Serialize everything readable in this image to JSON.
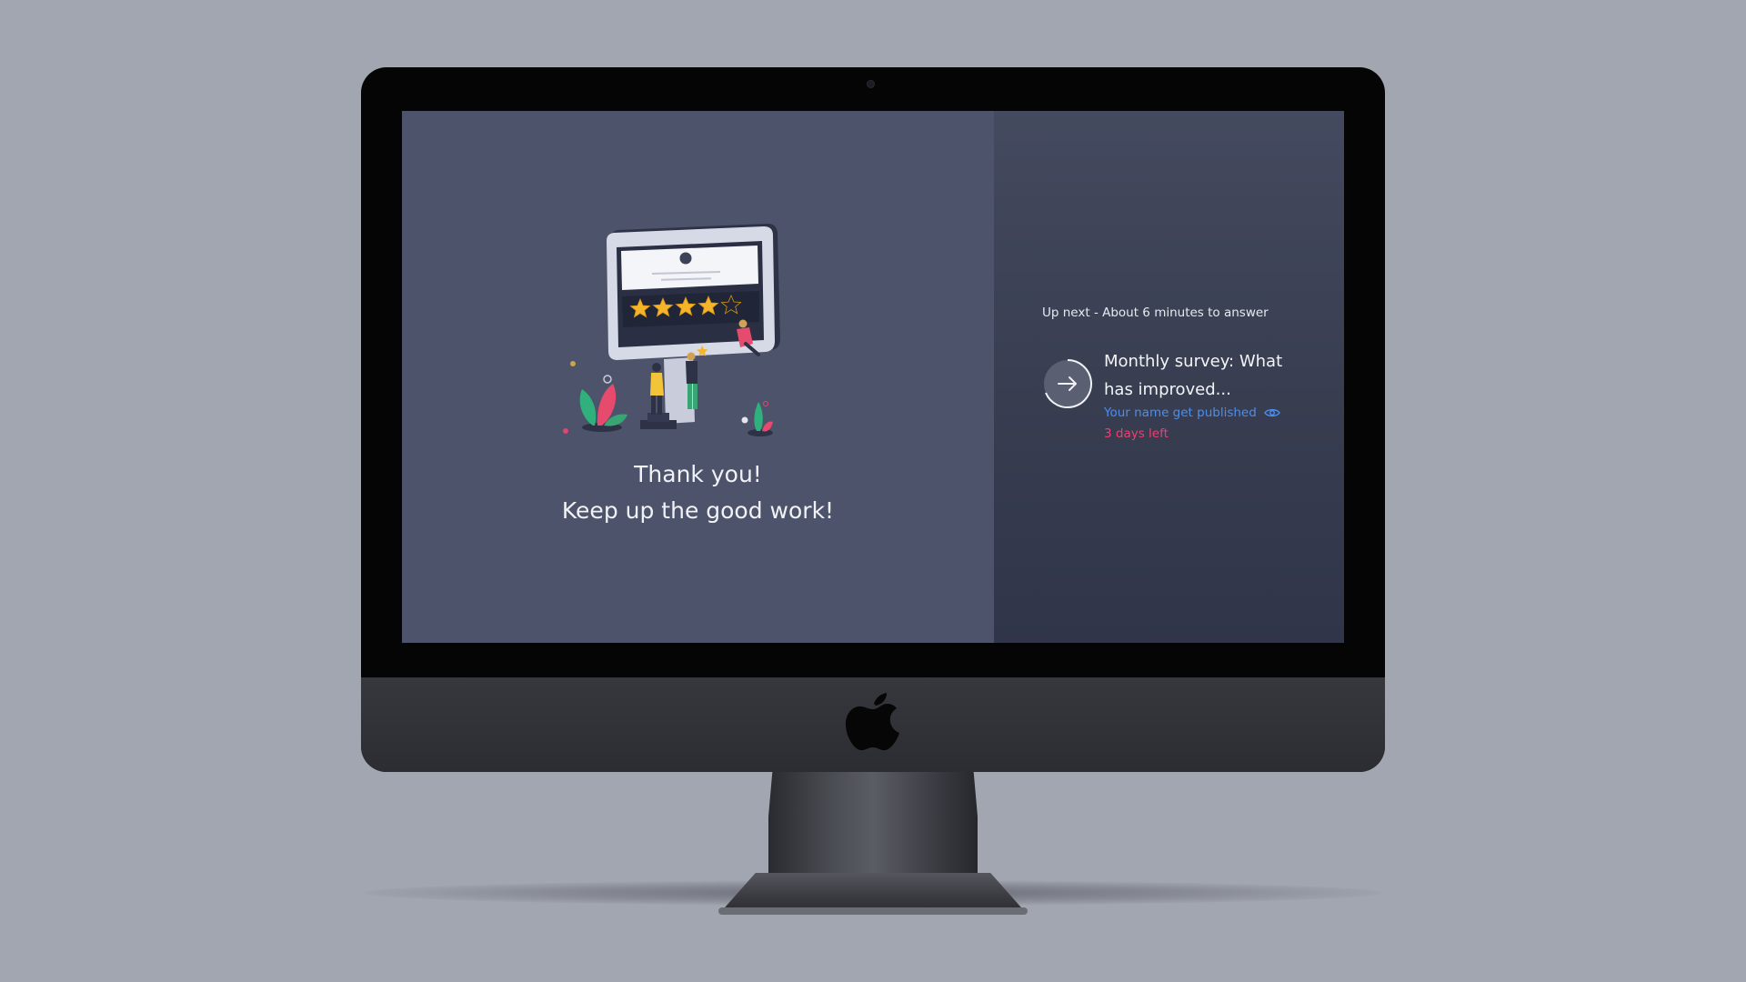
{
  "thank_you": {
    "line1": "Thank you!",
    "line2": "Keep up the good work!"
  },
  "up_next": {
    "header": "Up next - About 6 minutes to answer",
    "survey_title": "Monthly survey: What has improved...",
    "publish_note": "Your name get published",
    "deadline": "3 days left",
    "publish_icon": "eye-icon",
    "next_icon": "arrow-right-icon"
  },
  "illustration": {
    "rating": 4,
    "max_rating": 5
  },
  "colors": {
    "left_pane": "#4c536b",
    "right_pane": "#3b4055",
    "link_blue": "#4a8ef0",
    "deadline_red": "#ee3f73",
    "star_gold": "#f5b52a"
  }
}
